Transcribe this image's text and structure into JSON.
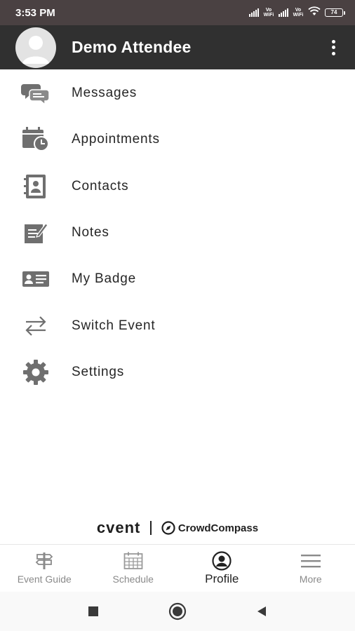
{
  "status_bar": {
    "time": "3:53 PM",
    "vowifi_label": "Vo WiFi",
    "battery": "74"
  },
  "header": {
    "title": "Demo Attendee"
  },
  "menu": {
    "items": [
      {
        "label": "Messages",
        "icon": "chat-bubbles-icon"
      },
      {
        "label": "Appointments",
        "icon": "calendar-clock-icon"
      },
      {
        "label": "Contacts",
        "icon": "address-book-icon"
      },
      {
        "label": "Notes",
        "icon": "note-edit-icon"
      },
      {
        "label": "My Badge",
        "icon": "badge-card-icon"
      },
      {
        "label": "Switch Event",
        "icon": "switch-arrows-icon"
      },
      {
        "label": "Settings",
        "icon": "gear-icon"
      }
    ]
  },
  "branding": {
    "cvent": "cvent",
    "crowdcompass": "CrowdCompass"
  },
  "tabs": [
    {
      "label": "Event Guide",
      "icon": "signpost-icon",
      "active": false
    },
    {
      "label": "Schedule",
      "icon": "calendar-grid-icon",
      "active": false
    },
    {
      "label": "Profile",
      "icon": "profile-icon",
      "active": true
    },
    {
      "label": "More",
      "icon": "hamburger-icon",
      "active": false
    }
  ],
  "colors": {
    "header_bg": "#303030",
    "status_bg": "#4a4142",
    "icon_gray": "#6f6f6f",
    "active_tab": "#222222",
    "inactive_tab": "#8a8a8a"
  }
}
